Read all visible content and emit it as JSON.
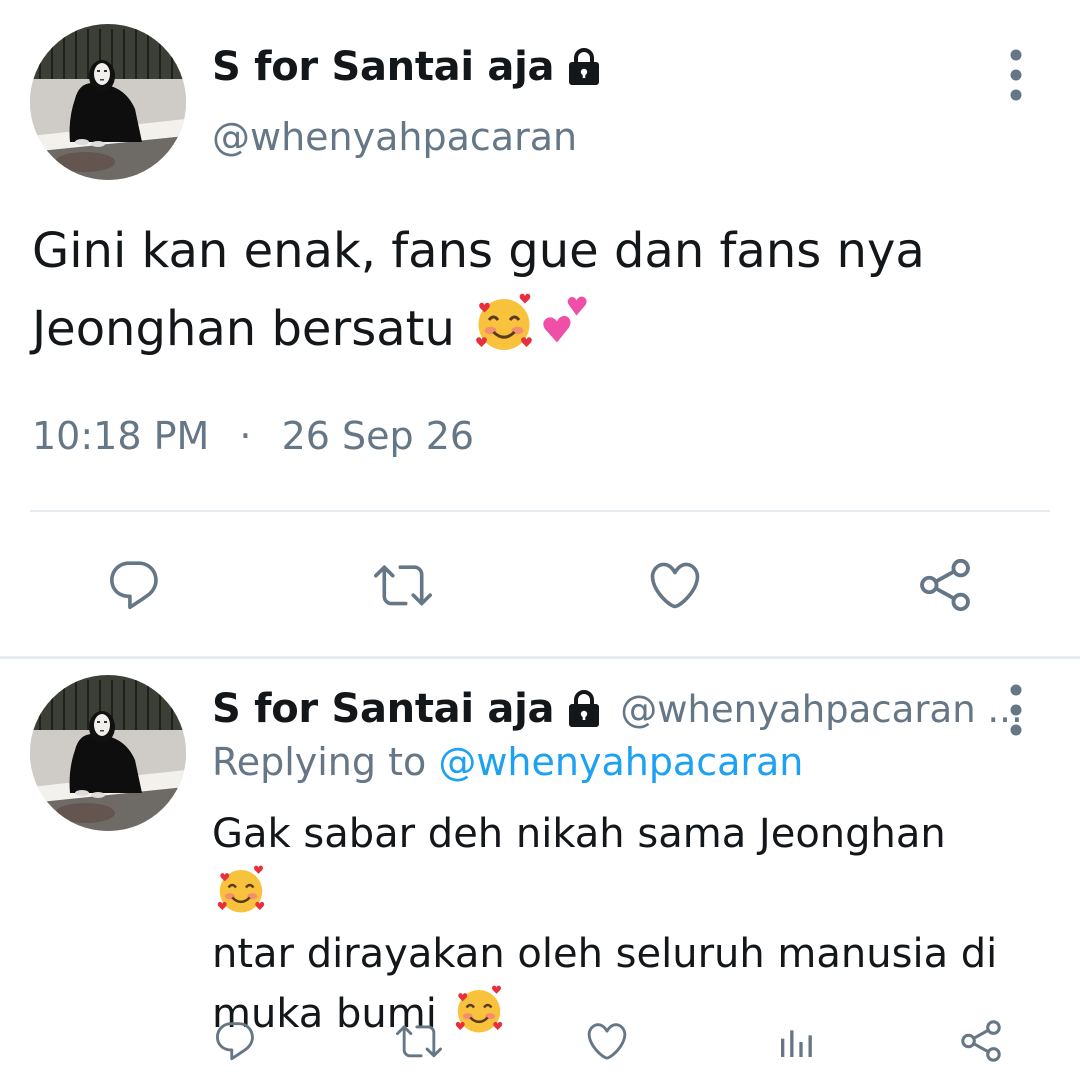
{
  "tweet": {
    "display_name": "S for Santai aja",
    "handle": "@whenyahpacaran",
    "text": "Gini kan enak, fans gue dan fans nya Jeonghan bersatu",
    "emojis": [
      "smiling-face-with-hearts",
      "two-hearts"
    ],
    "time": "10:18 PM",
    "separator": "·",
    "date": "26 Sep 26",
    "actions": [
      "reply-icon",
      "retweet-icon",
      "like-icon",
      "share-icon"
    ]
  },
  "reply": {
    "display_name": "S for Santai aja",
    "handle": "@whenyahpacaran ...",
    "replying_prefix": "Replying to",
    "replying_mention": "@whenyahpacaran",
    "text_line1": "Gak sabar deh nikah sama Jeonghan",
    "text_line2": "ntar dirayakan oleh seluruh manusia di",
    "text_line3": "muka bumi",
    "actions": [
      "reply-icon",
      "retweet-icon",
      "like-icon",
      "analytics-icon",
      "share-icon"
    ]
  },
  "colors": {
    "text": "#14171a",
    "secondary": "#657786",
    "link": "#1da1f2",
    "divider": "#e6ecf0"
  }
}
